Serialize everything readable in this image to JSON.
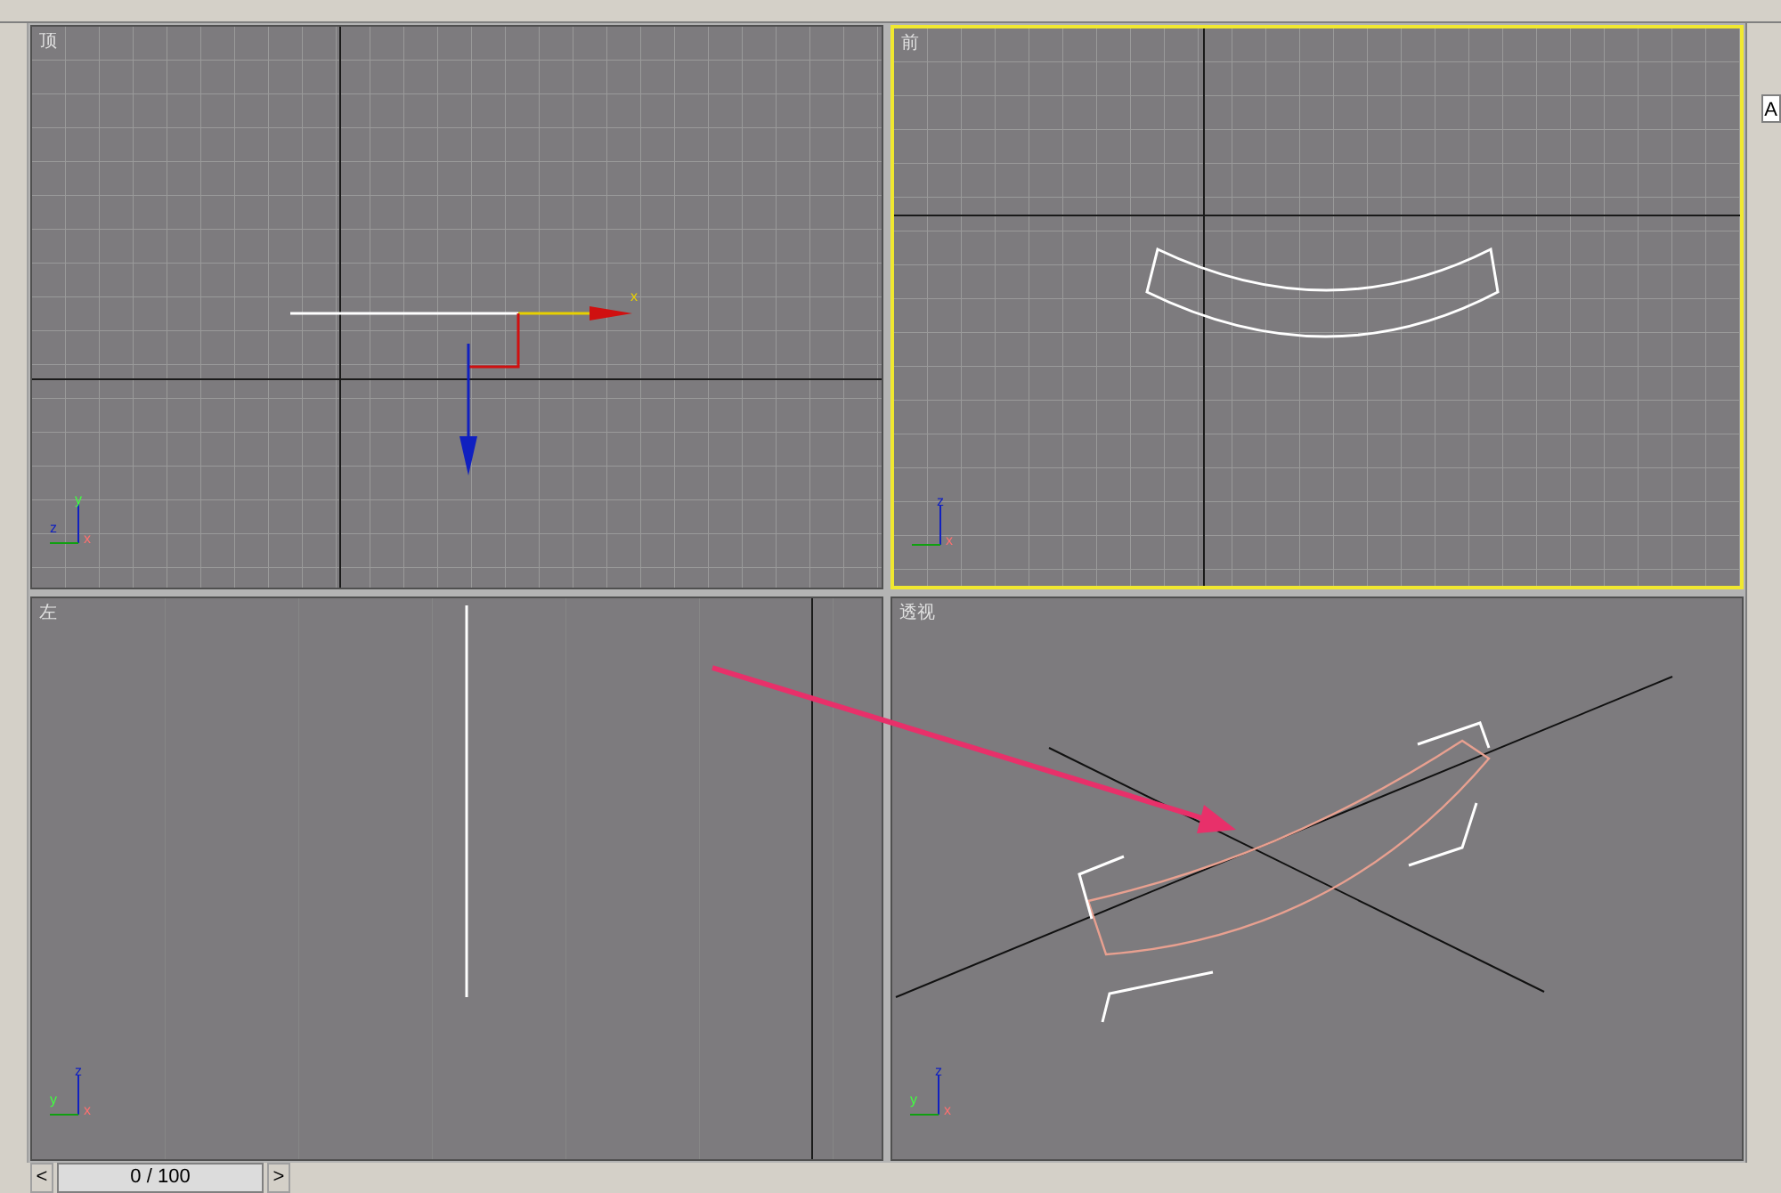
{
  "viewports": [
    {
      "kind": "top",
      "label": "顶",
      "selected": false,
      "axes": [
        "y",
        "z",
        "x"
      ],
      "gizmo_label": "x"
    },
    {
      "kind": "front",
      "label": "前",
      "selected": true,
      "axes": [
        "z",
        "x"
      ]
    },
    {
      "kind": "left",
      "label": "左",
      "selected": false,
      "axes": [
        "z",
        "y",
        "x"
      ]
    },
    {
      "kind": "perspective",
      "label": "透视",
      "selected": false,
      "axes": [
        "z",
        "y",
        "x"
      ]
    }
  ],
  "command_panel": {
    "field_1": "A"
  },
  "time_slider": {
    "prev": "<",
    "position": "0 / 100",
    "next": ">",
    "level": 0
  }
}
